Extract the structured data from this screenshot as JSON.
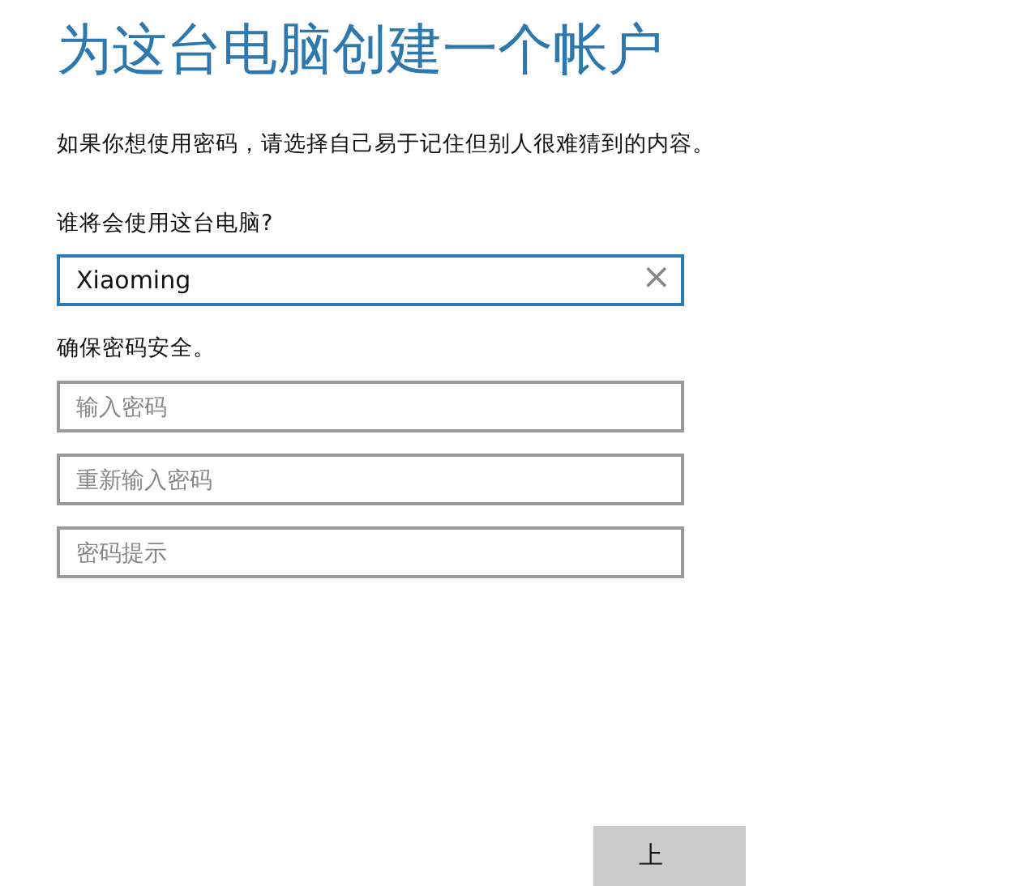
{
  "title": "为这台电脑创建一个帐户",
  "description": "如果你想使用密码，请选择自己易于记住但别人很难猜到的内容。",
  "user_section": {
    "label": "谁将会使用这台电脑?",
    "field": {
      "value": "Xiaoming",
      "focused": true,
      "clear_button": "×"
    }
  },
  "password_section": {
    "label": "确保密码安全。",
    "fields": [
      {
        "placeholder": "输入密码"
      },
      {
        "placeholder": "重新输入密码"
      },
      {
        "placeholder": "密码提示"
      }
    ]
  },
  "buttons": [
    {
      "label": "上"
    }
  ]
}
